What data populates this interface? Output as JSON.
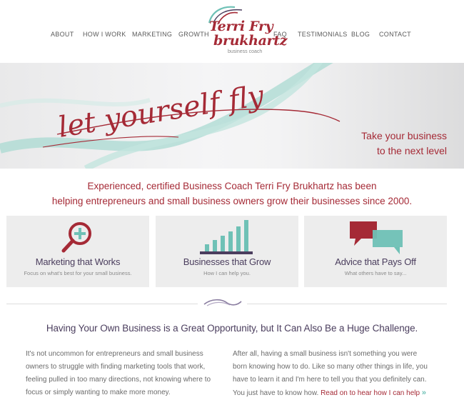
{
  "nav": {
    "left": [
      "ABOUT",
      "HOW I WORK",
      "MARKETING",
      "GROWTH"
    ],
    "right": [
      "FAQ",
      "TESTIMONIALS",
      "BLOG",
      "CONTACT"
    ]
  },
  "logo": {
    "line1": "Terri Fry",
    "line2": "brukhartz",
    "sub": "business coach"
  },
  "hero": {
    "script": "let yourself fly",
    "tagline_1": "Take your business",
    "tagline_2": "to the next level"
  },
  "intro": {
    "line1": "Experienced, certified Business Coach Terri Fry Brukhartz has been",
    "line2": "helping entrepreneurs and small business owners grow their businesses since 2000."
  },
  "cards": [
    {
      "title": "Marketing that Works",
      "sub": "Focus on what's best for your small business.",
      "icon": "magnifier-plus-icon"
    },
    {
      "title": "Businesses that Grow",
      "sub": "How I can help you.",
      "icon": "growth-bars-icon"
    },
    {
      "title": "Advice that Pays Off",
      "sub": "What others have to say...",
      "icon": "speech-bubbles-icon"
    }
  ],
  "headline": "Having Your Own Business is a Great Opportunity, but It Can Also Be a Huge Challenge.",
  "body": {
    "left": [
      "It's not uncommon for entrepreneurs and small business",
      "owners to struggle with finding marketing tools that work,",
      "feeling pulled in too many directions, not knowing where to",
      "focus or simply wanting to make more money."
    ],
    "right": [
      "After all, having a small business isn't something you were",
      "born knowing how to do. Like so many other things in life, you",
      "have to learn it and I'm here to tell you that you definitely can.",
      "You just have to know how."
    ],
    "read_on": "Read on to hear how I can help",
    "read_on_arrow": "»"
  },
  "colors": {
    "brand_red": "#a52a36",
    "teal": "#6fc1b6",
    "purple": "#4b3e5e"
  }
}
